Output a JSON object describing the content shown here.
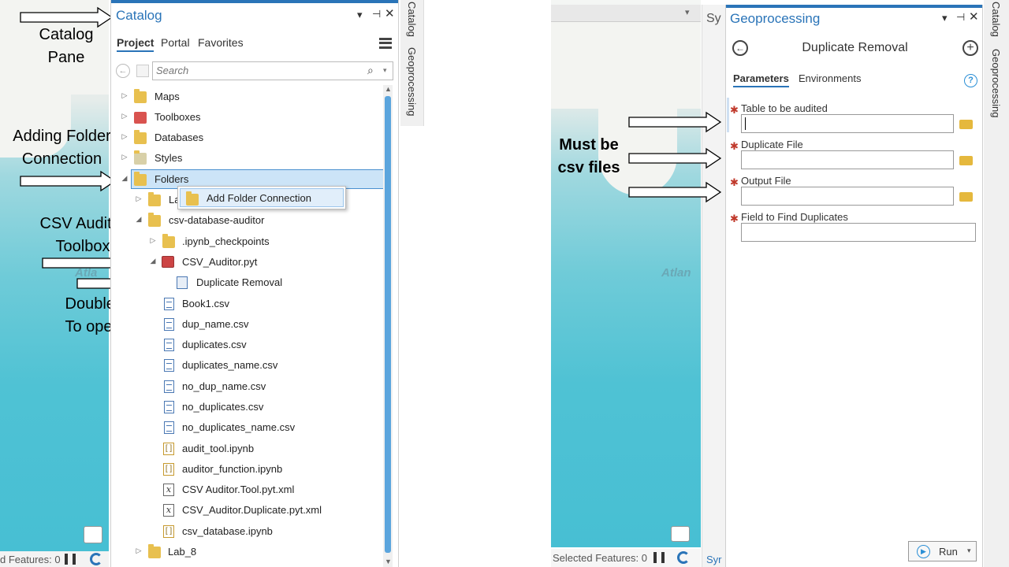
{
  "annotations": {
    "catalog_pane": "Catalog\nPane",
    "adding_folder": "Adding Folder\nConnection",
    "csv_auditor": "CSV Auditor\nToolbox",
    "double_click": "Double-click\nTo open tool",
    "must_be_csv": "Must be\ncsv files"
  },
  "left_map": {
    "ocean_label": "Atla",
    "status_text": "d Features: 0"
  },
  "catalog": {
    "title": "Catalog",
    "tabs": [
      "Project",
      "Portal",
      "Favorites"
    ],
    "search_placeholder": "Search",
    "tree": [
      {
        "label": "Maps",
        "icon": "maps-folder-icon"
      },
      {
        "label": "Toolboxes",
        "icon": "toolbox-folder-icon"
      },
      {
        "label": "Databases",
        "icon": "database-folder-icon"
      },
      {
        "label": "Styles",
        "icon": "styles-folder-icon"
      },
      {
        "label": "Folders",
        "icon": "folder-icon"
      },
      {
        "label": "La",
        "icon": "folder-home-icon"
      },
      {
        "label": "csv-database-auditor",
        "icon": "folder-icon"
      },
      {
        "label": ".ipynb_checkpoints",
        "icon": "folder-icon"
      },
      {
        "label": "CSV_Auditor.pyt",
        "icon": "python-toolbox-icon"
      },
      {
        "label": "Duplicate Removal",
        "icon": "script-tool-icon"
      },
      {
        "label": "Book1.csv",
        "icon": "csv-file-icon"
      },
      {
        "label": "dup_name.csv",
        "icon": "csv-file-icon"
      },
      {
        "label": "duplicates.csv",
        "icon": "csv-file-icon"
      },
      {
        "label": "duplicates_name.csv",
        "icon": "csv-file-icon"
      },
      {
        "label": "no_dup_name.csv",
        "icon": "csv-file-icon"
      },
      {
        "label": "no_duplicates.csv",
        "icon": "csv-file-icon"
      },
      {
        "label": "no_duplicates_name.csv",
        "icon": "csv-file-icon"
      },
      {
        "label": "audit_tool.ipynb",
        "icon": "notebook-icon"
      },
      {
        "label": "auditor_function.ipynb",
        "icon": "notebook-icon"
      },
      {
        "label": "CSV Auditor.Tool.pyt.xml",
        "icon": "xml-file-icon"
      },
      {
        "label": "CSV_Auditor.Duplicate.pyt.xml",
        "icon": "xml-file-icon"
      },
      {
        "label": "csv_database.ipynb",
        "icon": "notebook-icon"
      },
      {
        "label": "Lab_8",
        "icon": "folder-icon"
      }
    ],
    "context_menu_item": "Add Folder Connection",
    "side_tabs": [
      "Catalog",
      "Geoprocessing"
    ]
  },
  "right_map": {
    "ocean_label": "Atlan",
    "status_text": "Selected Features: 0",
    "partial_tab": "Sy",
    "partial_status": "Syr"
  },
  "geoprocessing": {
    "title": "Geoprocessing",
    "tool_name": "Duplicate Removal",
    "tabs": [
      "Parameters",
      "Environments"
    ],
    "fields": [
      {
        "label": "Table to be audited",
        "required": true,
        "value": "",
        "browse": true
      },
      {
        "label": "Duplicate File",
        "required": true,
        "value": "",
        "browse": true
      },
      {
        "label": "Output File",
        "required": true,
        "value": "",
        "browse": true
      },
      {
        "label": "Field to Find Duplicates",
        "required": true,
        "value": "",
        "browse": false
      }
    ],
    "run_label": "Run",
    "side_tabs": [
      "Catalog",
      "Geoprocessing"
    ]
  },
  "colors": {
    "accent": "#2a74b8",
    "selection": "#cce4f7",
    "required": "#c0392b"
  }
}
